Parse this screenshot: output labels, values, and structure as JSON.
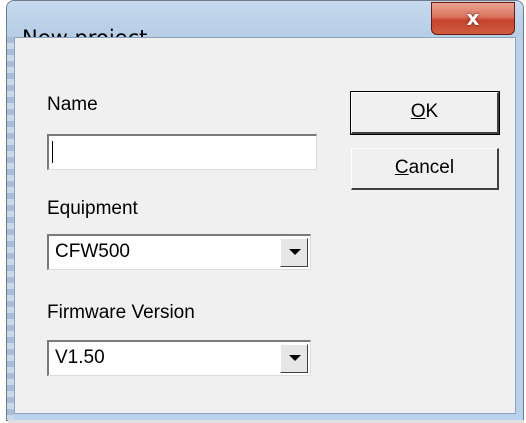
{
  "window": {
    "title": "New project",
    "close_glyph": "x"
  },
  "form": {
    "name_label": "Name",
    "name_value": "",
    "equipment_label": "Equipment",
    "equipment_selected": "CFW500",
    "firmware_label": "Firmware Version",
    "firmware_selected": "V1.50"
  },
  "buttons": {
    "ok_accel": "O",
    "ok_rest": "K",
    "cancel_accel": "C",
    "cancel_rest": "ancel"
  },
  "icons": {
    "close": "close-icon",
    "dropdown": "chevron-down-icon"
  },
  "colors": {
    "titlebar": "#b9d1ea",
    "client": "#f0f0f0",
    "close_button": "#c5432b"
  }
}
